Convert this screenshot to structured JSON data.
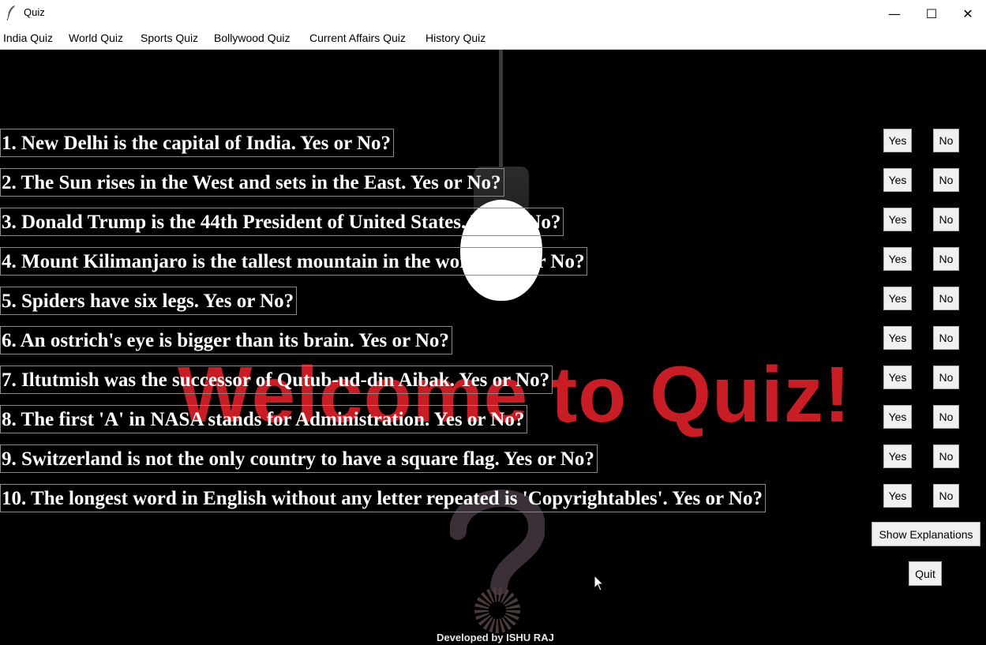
{
  "window": {
    "title": "Quiz",
    "controls": {
      "minimize": "—",
      "maximize": "☐",
      "close": "✕"
    }
  },
  "menu": [
    "India Quiz",
    "World Quiz",
    "Sports Quiz",
    "Bollywood Quiz",
    "Current Affairs Quiz",
    "History Quiz"
  ],
  "background": {
    "welcome_text": "Welcome to Quiz!",
    "accent_color": "#c81d25"
  },
  "questions": [
    "1. New Delhi is the capital of India. Yes or No?",
    "2. The Sun rises in the West and sets in the East. Yes or No?",
    "3. Donald Trump is the 44th President of United States. Yes or No?",
    "4. Mount Kilimanjaro is the tallest mountain in the world. Yes or No?",
    "5. Spiders have six legs. Yes or No?",
    "6. An ostrich's eye is bigger than its brain. Yes or No?",
    "7. Iltutmish was the successor of Qutub-ud-din Aibak. Yes or No?",
    "8. The first 'A' in NASA stands for Administration. Yes or No?",
    "9. Switzerland is not the only country to have a square flag. Yes or No?",
    "10. The longest word in English without any letter repeated is 'Copyrightables'. Yes or No?"
  ],
  "answer_buttons": {
    "yes": "Yes",
    "no": "No"
  },
  "actions": {
    "explanations": "Show Explanations",
    "quit": "Quit"
  },
  "footer": "Developed by ISHU RAJ"
}
